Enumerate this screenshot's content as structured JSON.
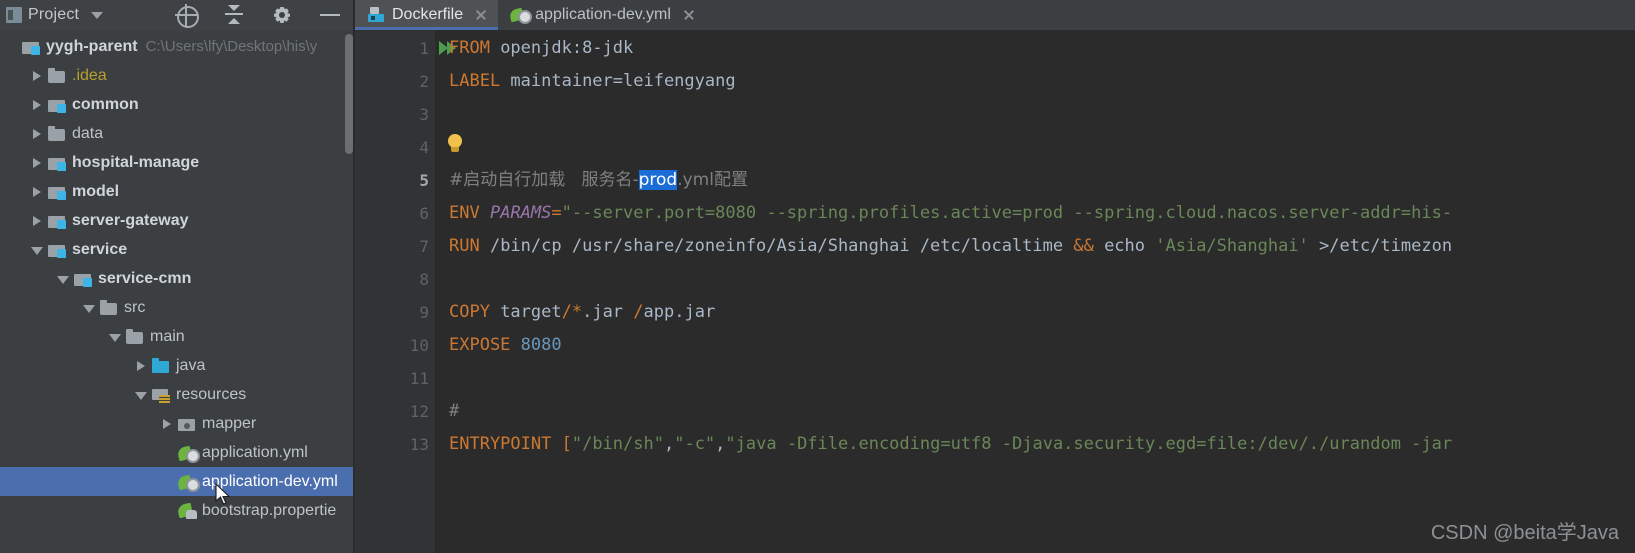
{
  "project_panel": {
    "title": "Project",
    "window_icon": "project-window-icon",
    "dropdown_icon": "chevron-down-icon",
    "toolbar": [
      {
        "name": "locate-target-button",
        "icon": "target-icon",
        "label": ""
      },
      {
        "name": "collapse-all-button",
        "icon": "collapse-all-icon",
        "label": ""
      },
      {
        "name": "settings-button",
        "icon": "gear-icon",
        "label": ""
      },
      {
        "name": "hide-panel-button",
        "icon": "minimize-icon",
        "label": ""
      }
    ],
    "tree": [
      {
        "label": "yygh-parent",
        "path": "C:\\Users\\lfy\\Desktop\\his\\y",
        "indent": 0,
        "arrow": "none",
        "icon": "module",
        "style": "bold",
        "selected": false
      },
      {
        "label": ".idea",
        "path": "",
        "indent": 1,
        "arrow": "right",
        "icon": "folder",
        "style": "yellow",
        "selected": false
      },
      {
        "label": "common",
        "path": "",
        "indent": 1,
        "arrow": "right",
        "icon": "module",
        "style": "bold",
        "selected": false
      },
      {
        "label": "data",
        "path": "",
        "indent": 1,
        "arrow": "right",
        "icon": "folder",
        "style": "normal",
        "selected": false
      },
      {
        "label": "hospital-manage",
        "path": "",
        "indent": 1,
        "arrow": "right",
        "icon": "module",
        "style": "bold",
        "selected": false
      },
      {
        "label": "model",
        "path": "",
        "indent": 1,
        "arrow": "right",
        "icon": "module",
        "style": "bold",
        "selected": false
      },
      {
        "label": "server-gateway",
        "path": "",
        "indent": 1,
        "arrow": "right",
        "icon": "module",
        "style": "bold",
        "selected": false
      },
      {
        "label": "service",
        "path": "",
        "indent": 1,
        "arrow": "down",
        "icon": "module",
        "style": "bold",
        "selected": false
      },
      {
        "label": "service-cmn",
        "path": "",
        "indent": 2,
        "arrow": "down",
        "icon": "module",
        "style": "bold",
        "selected": false
      },
      {
        "label": "src",
        "path": "",
        "indent": 3,
        "arrow": "down",
        "icon": "folder",
        "style": "normal",
        "selected": false
      },
      {
        "label": "main",
        "path": "",
        "indent": 4,
        "arrow": "down",
        "icon": "folder",
        "style": "normal",
        "selected": false
      },
      {
        "label": "java",
        "path": "",
        "indent": 5,
        "arrow": "right",
        "icon": "srcfolder",
        "style": "normal",
        "selected": false
      },
      {
        "label": "resources",
        "path": "",
        "indent": 5,
        "arrow": "down",
        "icon": "resfolder",
        "style": "normal",
        "selected": false
      },
      {
        "label": "mapper",
        "path": "",
        "indent": 6,
        "arrow": "right",
        "icon": "dotfolder",
        "style": "normal",
        "selected": false
      },
      {
        "label": "application.yml",
        "path": "",
        "indent": 6,
        "arrow": "none",
        "icon": "spring",
        "style": "normal",
        "selected": false
      },
      {
        "label": "application-dev.yml",
        "path": "",
        "indent": 6,
        "arrow": "none",
        "icon": "spring",
        "style": "normal",
        "selected": true
      },
      {
        "label": "bootstrap.propertie",
        "path": "",
        "indent": 6,
        "arrow": "none",
        "icon": "springprop",
        "style": "normal",
        "selected": false
      }
    ]
  },
  "editor": {
    "tabs": [
      {
        "label": "Dockerfile",
        "icon": "docker-icon",
        "active": true,
        "close_icon": "close-icon"
      },
      {
        "label": "application-dev.yml",
        "icon": "spring-yml-icon",
        "active": false,
        "close_icon": "close-icon"
      }
    ],
    "gutter": {
      "line_numbers": [
        "1",
        "2",
        "3",
        "4",
        "5",
        "6",
        "7",
        "8",
        "9",
        "10",
        "11",
        "12",
        "13"
      ],
      "current_line": "5",
      "run_all_icon": "run-all-icon",
      "intention_bulb_icon": "lightbulb-icon"
    },
    "lines": [
      {
        "n": "1",
        "tokens": [
          {
            "t": "FROM",
            "c": "kw"
          },
          {
            "t": " openjdk:8-jdk",
            "c": "txt"
          }
        ]
      },
      {
        "n": "2",
        "tokens": [
          {
            "t": "LABEL",
            "c": "kw"
          },
          {
            "t": " maintainer=leifengyang",
            "c": "txt"
          }
        ]
      },
      {
        "n": "3",
        "tokens": []
      },
      {
        "n": "4",
        "tokens": []
      },
      {
        "n": "5",
        "tokens": [
          {
            "t": "#启动自行加载   服务名-",
            "c": "cmt cn"
          },
          {
            "t": "prod",
            "c": "sel cn"
          },
          {
            "t": ".yml配置",
            "c": "cmt cn"
          }
        ]
      },
      {
        "n": "6",
        "tokens": [
          {
            "t": "ENV",
            "c": "kw"
          },
          {
            "t": " ",
            "c": "txt"
          },
          {
            "t": "PARAMS",
            "c": "var"
          },
          {
            "t": "=",
            "c": "op"
          },
          {
            "t": "\"--server.port=8080 --spring.profiles.active=prod --spring.cloud.nacos.server-addr=his-",
            "c": "str"
          }
        ]
      },
      {
        "n": "7",
        "tokens": [
          {
            "t": "RUN",
            "c": "kw"
          },
          {
            "t": " /bin/cp /usr/share/zoneinfo/Asia/Shanghai /etc/localtime ",
            "c": "txt"
          },
          {
            "t": "&&",
            "c": "op"
          },
          {
            "t": " echo ",
            "c": "txt"
          },
          {
            "t": "'Asia/Shanghai'",
            "c": "str"
          },
          {
            "t": " >/etc/timezon",
            "c": "txt"
          }
        ]
      },
      {
        "n": "8",
        "tokens": []
      },
      {
        "n": "9",
        "tokens": [
          {
            "t": "COPY",
            "c": "kw"
          },
          {
            "t": " target",
            "c": "txt"
          },
          {
            "t": "/*",
            "c": "op"
          },
          {
            "t": ".jar ",
            "c": "txt"
          },
          {
            "t": "/",
            "c": "op"
          },
          {
            "t": "app.jar",
            "c": "txt"
          }
        ]
      },
      {
        "n": "10",
        "tokens": [
          {
            "t": "EXPOSE",
            "c": "kw"
          },
          {
            "t": " ",
            "c": "txt"
          },
          {
            "t": "8080",
            "c": "num"
          }
        ]
      },
      {
        "n": "11",
        "tokens": []
      },
      {
        "n": "12",
        "tokens": [
          {
            "t": "#",
            "c": "cmt"
          }
        ]
      },
      {
        "n": "13",
        "tokens": [
          {
            "t": "ENTRYPOINT",
            "c": "kw"
          },
          {
            "t": " [",
            "c": "op"
          },
          {
            "t": "\"/bin/sh\"",
            "c": "str"
          },
          {
            "t": ",",
            "c": "txt"
          },
          {
            "t": "\"-c\"",
            "c": "str"
          },
          {
            "t": ",",
            "c": "txt"
          },
          {
            "t": "\"java -Dfile.encoding=utf8 -Djava.security.egd=file:/dev/./urandom -jar",
            "c": "str"
          }
        ]
      }
    ]
  },
  "watermark": {
    "text": "CSDN @beita学Java"
  },
  "colors": {
    "panel_bg": "#3c3f41",
    "editor_bg": "#2b2b2b",
    "gutter_bg": "#313335",
    "selection_blue": "#4b6eaf",
    "keyword_orange": "#cc7832",
    "string_green": "#6a8759",
    "number_blue": "#6897bb",
    "variable_purple": "#9876aa",
    "comment_grey": "#808080",
    "text_grey": "#a9b7c6",
    "inline_selection": "#1a6dd6"
  }
}
